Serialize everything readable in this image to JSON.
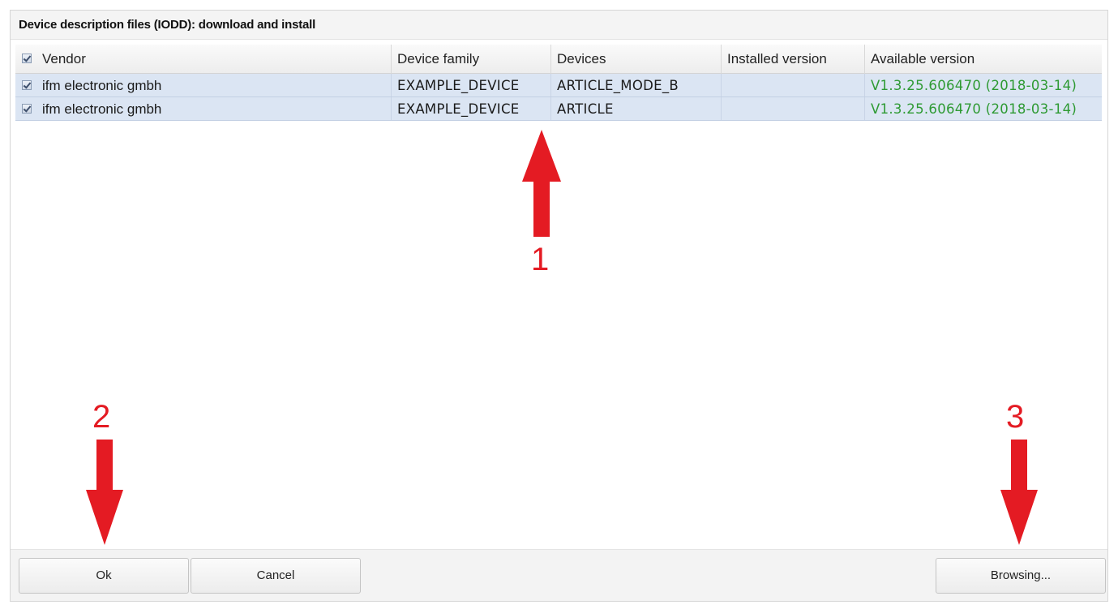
{
  "dialog": {
    "title": "Device description files (IODD): download and install"
  },
  "table": {
    "columns": [
      "Vendor",
      "Device family",
      "Devices",
      "Installed version",
      "Available version"
    ],
    "rows": [
      {
        "checked": true,
        "vendor": "ifm electronic gmbh",
        "device_family": "EXAMPLE_DEVICE",
        "devices": "ARTICLE_MODE_B",
        "installed_version": "",
        "available_version": "V1.3.25.606470 (2018-03-14)"
      },
      {
        "checked": true,
        "vendor": "ifm electronic gmbh",
        "device_family": "EXAMPLE_DEVICE",
        "devices": "ARTICLE",
        "installed_version": "",
        "available_version": "V1.3.25.606470 (2018-03-14)"
      }
    ]
  },
  "buttons": {
    "ok": "Ok",
    "cancel": "Cancel",
    "browsing": "Browsing..."
  },
  "annotations": {
    "marker_1": "1",
    "marker_2": "2",
    "marker_3": "3"
  },
  "colors": {
    "annotation_red": "#e41b23",
    "available_version_green": "#2e9a33",
    "selected_row_blue": "#dbe5f3"
  }
}
